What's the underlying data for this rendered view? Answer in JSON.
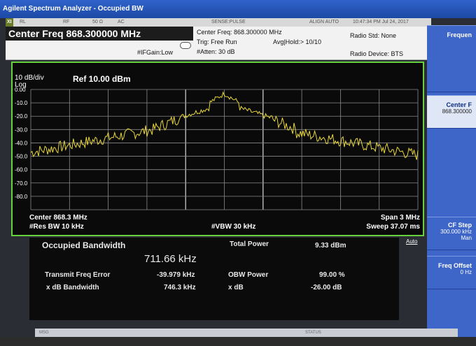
{
  "window": {
    "title": "Agilent Spectrum Analyzer - Occupied BW"
  },
  "status_strip": {
    "indicator": "XI",
    "rl": "RL",
    "rf": "RF",
    "impedance": "50 Ω",
    "coupling": "AC",
    "sense": "SENSE:PULSE",
    "align": "ALIGN AUTO",
    "timestamp": "10:47:34 PM Jul 24, 2017"
  },
  "header": {
    "center_freq_big": "Center Freq  868.300000 MHz",
    "ifgain": "#IFGain:Low",
    "center_freq_small": "Center Freq: 868.300000 MHz",
    "trig": "Trig: Free Run",
    "avg_hold": "Avg|Hold:> 10/10",
    "atten": "#Atten: 30 dB",
    "radio_std": "Radio Std: None",
    "radio_device": "Radio Device: BTS"
  },
  "softkeys": [
    {
      "label": "Frequen",
      "value": ""
    },
    {
      "label": "Center F",
      "value": "868.300000"
    },
    {
      "label": "CF Step",
      "value": "300.000 kHz",
      "mode_left": "Auto",
      "mode_right": "Man"
    },
    {
      "label": "Freq Offset",
      "value": "0 Hz"
    }
  ],
  "plot": {
    "scale": "10 dB/div",
    "log": "Log",
    "ref_level": "Ref 10.00 dBm",
    "y_labels": [
      "0.00",
      "-10.0",
      "-20.0",
      "-30.0",
      "-40.0",
      "-50.0",
      "-60.0",
      "-70.0",
      "-80.0"
    ],
    "center": "Center  868.3 MHz",
    "res_bw": "#Res BW  10 kHz",
    "vbw": "#VBW  30 kHz",
    "span": "Span 3 MHz",
    "sweep": "Sweep  37.07 ms",
    "trace_color": "#e8d63a",
    "grid_color": "#8a8a8a"
  },
  "results": {
    "occupied_bw_label": "Occupied Bandwidth",
    "occupied_bw_value": "711.66 kHz",
    "total_power_label": "Total Power",
    "total_power_value": "9.33 dBm",
    "transmit_freq_error_label": "Transmit Freq Error",
    "transmit_freq_error_value": "-39.979 kHz",
    "obw_power_label": "OBW Power",
    "obw_power_value": "99.00 %",
    "xdb_bandwidth_label": "x dB Bandwidth",
    "xdb_bandwidth_value": "746.3 kHz",
    "xdb_label": "x dB",
    "xdb_value": "-26.00 dB"
  },
  "bottom_bar": {
    "msg": "MSG",
    "status": "STATUS"
  }
}
